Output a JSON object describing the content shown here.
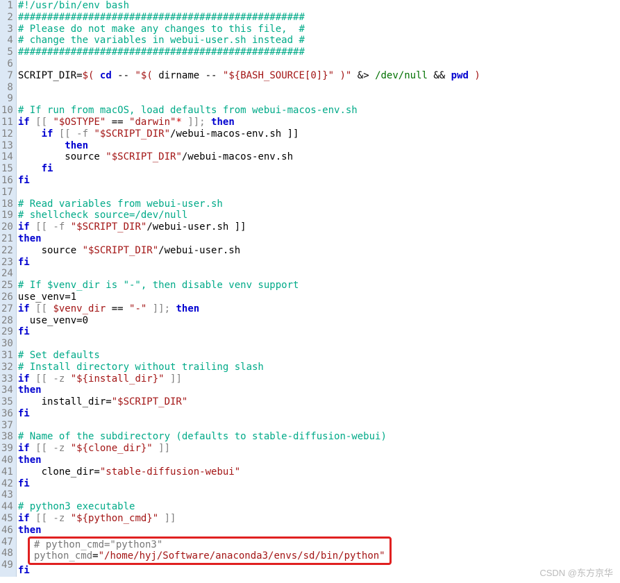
{
  "watermark": "CSDN @东方京华",
  "lines": [
    {
      "n": 1,
      "tokens": [
        {
          "t": "#!/usr/bin/env bash",
          "c": "tok-comment"
        }
      ]
    },
    {
      "n": 2,
      "tokens": [
        {
          "t": "#################################################",
          "c": "tok-comment"
        }
      ]
    },
    {
      "n": 3,
      "tokens": [
        {
          "t": "# Please do not make any changes to this file,  #",
          "c": "tok-comment"
        }
      ]
    },
    {
      "n": 4,
      "tokens": [
        {
          "t": "# change the variables in webui-user.sh instead #",
          "c": "tok-comment"
        }
      ]
    },
    {
      "n": 5,
      "tokens": [
        {
          "t": "#################################################",
          "c": "tok-comment"
        }
      ]
    },
    {
      "n": 6,
      "tokens": []
    },
    {
      "n": 7,
      "tokens": [
        {
          "t": "SCRIPT_DIR",
          "c": "tok-id"
        },
        {
          "t": "=",
          "c": "tok-op"
        },
        {
          "t": "$( ",
          "c": "tok-str"
        },
        {
          "t": "cd",
          "c": "tok-kw"
        },
        {
          "t": " -- ",
          "c": "tok-op"
        },
        {
          "t": "\"$( ",
          "c": "tok-str"
        },
        {
          "t": "dirname -- ",
          "c": "tok-id"
        },
        {
          "t": "\"${BASH_SOURCE[0]}\"",
          "c": "tok-str"
        },
        {
          "t": " )\"",
          "c": "tok-str"
        },
        {
          "t": " &> ",
          "c": "tok-op"
        },
        {
          "t": "/dev/null",
          "c": "tok-dev"
        },
        {
          "t": " && ",
          "c": "tok-op"
        },
        {
          "t": "pwd",
          "c": "tok-kw"
        },
        {
          "t": " )",
          "c": "tok-str"
        }
      ]
    },
    {
      "n": 8,
      "tokens": []
    },
    {
      "n": 9,
      "tokens": []
    },
    {
      "n": 10,
      "tokens": [
        {
          "t": "# If run from macOS, load defaults from webui-macos-env.sh",
          "c": "tok-comment"
        }
      ]
    },
    {
      "n": 11,
      "tokens": [
        {
          "t": "if",
          "c": "tok-kw"
        },
        {
          "t": " [[ ",
          "c": "tok-punct"
        },
        {
          "t": "\"$OSTYPE\"",
          "c": "tok-str"
        },
        {
          "t": " == ",
          "c": "tok-op"
        },
        {
          "t": "\"darwin\"",
          "c": "tok-str"
        },
        {
          "t": "*",
          "c": "tok-glob"
        },
        {
          "t": " ]]; ",
          "c": "tok-punct"
        },
        {
          "t": "then",
          "c": "tok-kw"
        }
      ]
    },
    {
      "n": 12,
      "tokens": [
        {
          "t": "    ",
          "c": ""
        },
        {
          "t": "if",
          "c": "tok-kw"
        },
        {
          "t": " [[ -f ",
          "c": "tok-punct"
        },
        {
          "t": "\"$SCRIPT_DIR\"",
          "c": "tok-str"
        },
        {
          "t": "/webui-macos-env.sh ]]",
          "c": "tok-id"
        }
      ]
    },
    {
      "n": 13,
      "tokens": [
        {
          "t": "        ",
          "c": ""
        },
        {
          "t": "then",
          "c": "tok-kw"
        }
      ]
    },
    {
      "n": 14,
      "tokens": [
        {
          "t": "        source ",
          "c": "tok-id"
        },
        {
          "t": "\"$SCRIPT_DIR\"",
          "c": "tok-str"
        },
        {
          "t": "/webui-macos-env.sh",
          "c": "tok-id"
        }
      ]
    },
    {
      "n": 15,
      "tokens": [
        {
          "t": "    ",
          "c": ""
        },
        {
          "t": "fi",
          "c": "tok-kw"
        }
      ]
    },
    {
      "n": 16,
      "tokens": [
        {
          "t": "fi",
          "c": "tok-kw"
        }
      ]
    },
    {
      "n": 17,
      "tokens": []
    },
    {
      "n": 18,
      "tokens": [
        {
          "t": "# Read variables from webui-user.sh",
          "c": "tok-comment"
        }
      ]
    },
    {
      "n": 19,
      "tokens": [
        {
          "t": "# shellcheck source=/dev/null",
          "c": "tok-comment"
        }
      ]
    },
    {
      "n": 20,
      "tokens": [
        {
          "t": "if",
          "c": "tok-kw"
        },
        {
          "t": " [[ -f ",
          "c": "tok-punct"
        },
        {
          "t": "\"$SCRIPT_DIR\"",
          "c": "tok-str"
        },
        {
          "t": "/webui-user.sh ]]",
          "c": "tok-id"
        }
      ]
    },
    {
      "n": 21,
      "tokens": [
        {
          "t": "then",
          "c": "tok-kw"
        }
      ]
    },
    {
      "n": 22,
      "tokens": [
        {
          "t": "    source ",
          "c": "tok-id"
        },
        {
          "t": "\"$SCRIPT_DIR\"",
          "c": "tok-str"
        },
        {
          "t": "/webui-user.sh",
          "c": "tok-id"
        }
      ]
    },
    {
      "n": 23,
      "tokens": [
        {
          "t": "fi",
          "c": "tok-kw"
        }
      ]
    },
    {
      "n": 24,
      "tokens": []
    },
    {
      "n": 25,
      "tokens": [
        {
          "t": "# If $venv_dir is \"-\", then disable venv support",
          "c": "tok-comment"
        }
      ]
    },
    {
      "n": 26,
      "tokens": [
        {
          "t": "use_venv=1",
          "c": "tok-id"
        }
      ]
    },
    {
      "n": 27,
      "tokens": [
        {
          "t": "if",
          "c": "tok-kw"
        },
        {
          "t": " [[ ",
          "c": "tok-punct"
        },
        {
          "t": "$venv_dir",
          "c": "tok-str"
        },
        {
          "t": " == ",
          "c": "tok-op"
        },
        {
          "t": "\"-\"",
          "c": "tok-str"
        },
        {
          "t": " ]]; ",
          "c": "tok-punct"
        },
        {
          "t": "then",
          "c": "tok-kw"
        }
      ]
    },
    {
      "n": 28,
      "tokens": [
        {
          "t": "  use_venv=0",
          "c": "tok-id"
        }
      ]
    },
    {
      "n": 29,
      "tokens": [
        {
          "t": "fi",
          "c": "tok-kw"
        }
      ]
    },
    {
      "n": 30,
      "tokens": []
    },
    {
      "n": 31,
      "tokens": [
        {
          "t": "# Set defaults",
          "c": "tok-comment"
        }
      ]
    },
    {
      "n": 32,
      "tokens": [
        {
          "t": "# Install directory without trailing slash",
          "c": "tok-comment"
        }
      ]
    },
    {
      "n": 33,
      "tokens": [
        {
          "t": "if",
          "c": "tok-kw"
        },
        {
          "t": " [[ -z ",
          "c": "tok-punct"
        },
        {
          "t": "\"${install_dir}\"",
          "c": "tok-str"
        },
        {
          "t": " ]]",
          "c": "tok-punct"
        }
      ]
    },
    {
      "n": 34,
      "tokens": [
        {
          "t": "then",
          "c": "tok-kw"
        }
      ]
    },
    {
      "n": 35,
      "tokens": [
        {
          "t": "    install_dir=",
          "c": "tok-id"
        },
        {
          "t": "\"$SCRIPT_DIR\"",
          "c": "tok-str"
        }
      ]
    },
    {
      "n": 36,
      "tokens": [
        {
          "t": "fi",
          "c": "tok-kw"
        }
      ]
    },
    {
      "n": 37,
      "tokens": []
    },
    {
      "n": 38,
      "tokens": [
        {
          "t": "# Name of the subdirectory (defaults to stable-diffusion-webui)",
          "c": "tok-comment"
        }
      ]
    },
    {
      "n": 39,
      "tokens": [
        {
          "t": "if",
          "c": "tok-kw"
        },
        {
          "t": " [[ -z ",
          "c": "tok-punct"
        },
        {
          "t": "\"${clone_dir}\"",
          "c": "tok-str"
        },
        {
          "t": " ]]",
          "c": "tok-punct"
        }
      ]
    },
    {
      "n": 40,
      "tokens": [
        {
          "t": "then",
          "c": "tok-kw"
        }
      ]
    },
    {
      "n": 41,
      "tokens": [
        {
          "t": "    clone_dir=",
          "c": "tok-id"
        },
        {
          "t": "\"stable-diffusion-webui\"",
          "c": "tok-str"
        }
      ]
    },
    {
      "n": 42,
      "tokens": [
        {
          "t": "fi",
          "c": "tok-kw"
        }
      ]
    },
    {
      "n": 43,
      "tokens": []
    },
    {
      "n": 44,
      "tokens": [
        {
          "t": "# python3 executable",
          "c": "tok-comment"
        }
      ]
    },
    {
      "n": 45,
      "tokens": [
        {
          "t": "if",
          "c": "tok-kw"
        },
        {
          "t": " [[ -z ",
          "c": "tok-punct"
        },
        {
          "t": "\"${python_cmd}\"",
          "c": "tok-str"
        },
        {
          "t": " ]]",
          "c": "tok-punct"
        }
      ]
    },
    {
      "n": 46,
      "tokens": [
        {
          "t": "then",
          "c": "tok-kw"
        }
      ]
    },
    {
      "n": 47,
      "hl": true,
      "tokens": [
        {
          "t": "# python_cmd=\"python3\"",
          "c": "tok-var"
        }
      ]
    },
    {
      "n": 48,
      "hl": true,
      "tokens": [
        {
          "t": "python_cmd",
          "c": "tok-var"
        },
        {
          "t": "=",
          "c": "tok-op"
        },
        {
          "t": "\"/home/hyj/Software/anaconda3/envs/sd/bin/python\"",
          "c": "tok-path"
        }
      ]
    },
    {
      "n": 49,
      "tokens": [
        {
          "t": "fi",
          "c": "tok-kw"
        }
      ]
    }
  ]
}
